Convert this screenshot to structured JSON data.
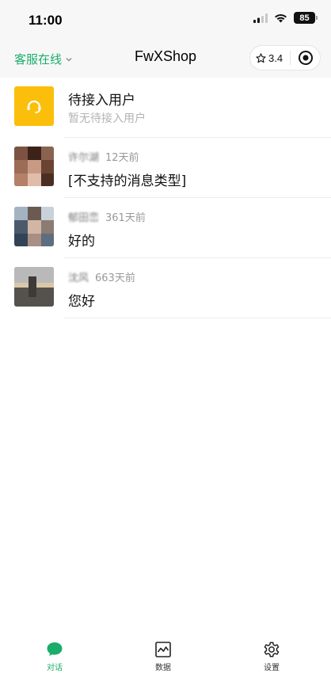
{
  "status_bar": {
    "time": "11:00",
    "battery": "85"
  },
  "nav": {
    "service_status": "客服在线",
    "title": "FwXShop",
    "rating": "3.4"
  },
  "pending": {
    "title": "待接入用户",
    "subtitle": "暂无待接入用户"
  },
  "conversations": [
    {
      "name": "许尔湖",
      "time": "12天前",
      "message": "[不支持的消息类型]"
    },
    {
      "name": "郁田峦",
      "time": "361天前",
      "message": "好的"
    },
    {
      "name": "沈风",
      "time": "663天前",
      "message": "您好"
    }
  ],
  "tabs": [
    {
      "label": "对话",
      "icon": "chat-bubble-icon",
      "active": true
    },
    {
      "label": "数据",
      "icon": "chart-icon",
      "active": false
    },
    {
      "label": "设置",
      "icon": "gear-icon",
      "active": false
    }
  ],
  "colors": {
    "accent": "#1aad6a",
    "pending_avatar": "#fbbf0b"
  }
}
